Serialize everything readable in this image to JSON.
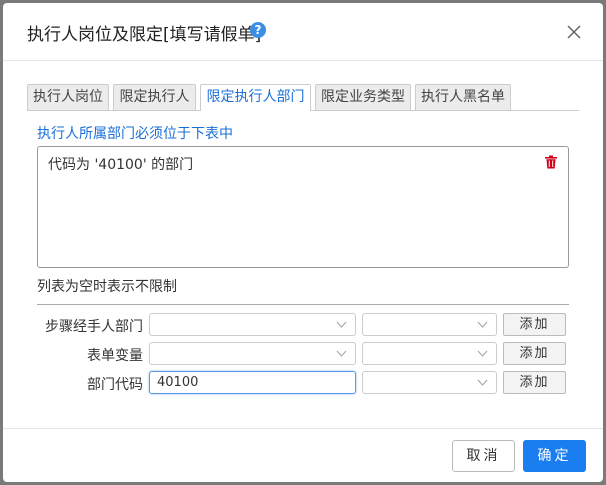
{
  "dialog": {
    "title": "执行人岗位及限定[填写请假单]",
    "help_glyph": "?",
    "help_icon": "help-icon",
    "close_icon": "close-icon",
    "accent_color": "#1a7ef0"
  },
  "tabs": [
    {
      "label": "执行人岗位",
      "active": false
    },
    {
      "label": "限定执行人",
      "active": false
    },
    {
      "label": "限定执行人部门",
      "active": true
    },
    {
      "label": "限定业务类型",
      "active": false
    },
    {
      "label": "执行人黑名单",
      "active": false
    }
  ],
  "section": {
    "title": "执行人所属部门必须位于下表中",
    "items": [
      {
        "text": "代码为 '40100' 的部门",
        "delete_icon": "trash-icon"
      }
    ],
    "note": "列表为空时表示不限制"
  },
  "rows": [
    {
      "label": "步骤经手人部门",
      "add_label": "添加"
    },
    {
      "label": "表单变量",
      "add_label": "添加"
    },
    {
      "label": "部门代码",
      "input_value": "40100",
      "add_label": "添加"
    }
  ],
  "footer": {
    "cancel_label": "取消",
    "ok_label": "确定"
  }
}
